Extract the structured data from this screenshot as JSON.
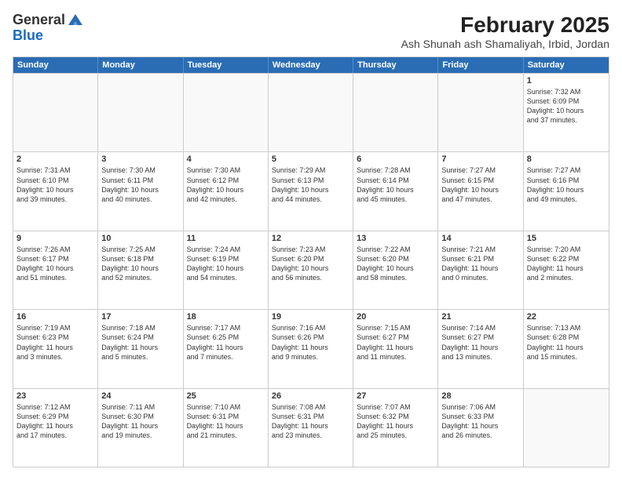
{
  "logo": {
    "general": "General",
    "blue": "Blue"
  },
  "title": "February 2025",
  "location": "Ash Shunah ash Shamaliyah, Irbid, Jordan",
  "days": [
    "Sunday",
    "Monday",
    "Tuesday",
    "Wednesday",
    "Thursday",
    "Friday",
    "Saturday"
  ],
  "weeks": [
    [
      {
        "day": "",
        "info": ""
      },
      {
        "day": "",
        "info": ""
      },
      {
        "day": "",
        "info": ""
      },
      {
        "day": "",
        "info": ""
      },
      {
        "day": "",
        "info": ""
      },
      {
        "day": "",
        "info": ""
      },
      {
        "day": "1",
        "info": "Sunrise: 7:32 AM\nSunset: 6:09 PM\nDaylight: 10 hours\nand 37 minutes."
      }
    ],
    [
      {
        "day": "2",
        "info": "Sunrise: 7:31 AM\nSunset: 6:10 PM\nDaylight: 10 hours\nand 39 minutes."
      },
      {
        "day": "3",
        "info": "Sunrise: 7:30 AM\nSunset: 6:11 PM\nDaylight: 10 hours\nand 40 minutes."
      },
      {
        "day": "4",
        "info": "Sunrise: 7:30 AM\nSunset: 6:12 PM\nDaylight: 10 hours\nand 42 minutes."
      },
      {
        "day": "5",
        "info": "Sunrise: 7:29 AM\nSunset: 6:13 PM\nDaylight: 10 hours\nand 44 minutes."
      },
      {
        "day": "6",
        "info": "Sunrise: 7:28 AM\nSunset: 6:14 PM\nDaylight: 10 hours\nand 45 minutes."
      },
      {
        "day": "7",
        "info": "Sunrise: 7:27 AM\nSunset: 6:15 PM\nDaylight: 10 hours\nand 47 minutes."
      },
      {
        "day": "8",
        "info": "Sunrise: 7:27 AM\nSunset: 6:16 PM\nDaylight: 10 hours\nand 49 minutes."
      }
    ],
    [
      {
        "day": "9",
        "info": "Sunrise: 7:26 AM\nSunset: 6:17 PM\nDaylight: 10 hours\nand 51 minutes."
      },
      {
        "day": "10",
        "info": "Sunrise: 7:25 AM\nSunset: 6:18 PM\nDaylight: 10 hours\nand 52 minutes."
      },
      {
        "day": "11",
        "info": "Sunrise: 7:24 AM\nSunset: 6:19 PM\nDaylight: 10 hours\nand 54 minutes."
      },
      {
        "day": "12",
        "info": "Sunrise: 7:23 AM\nSunset: 6:20 PM\nDaylight: 10 hours\nand 56 minutes."
      },
      {
        "day": "13",
        "info": "Sunrise: 7:22 AM\nSunset: 6:20 PM\nDaylight: 10 hours\nand 58 minutes."
      },
      {
        "day": "14",
        "info": "Sunrise: 7:21 AM\nSunset: 6:21 PM\nDaylight: 11 hours\nand 0 minutes."
      },
      {
        "day": "15",
        "info": "Sunrise: 7:20 AM\nSunset: 6:22 PM\nDaylight: 11 hours\nand 2 minutes."
      }
    ],
    [
      {
        "day": "16",
        "info": "Sunrise: 7:19 AM\nSunset: 6:23 PM\nDaylight: 11 hours\nand 3 minutes."
      },
      {
        "day": "17",
        "info": "Sunrise: 7:18 AM\nSunset: 6:24 PM\nDaylight: 11 hours\nand 5 minutes."
      },
      {
        "day": "18",
        "info": "Sunrise: 7:17 AM\nSunset: 6:25 PM\nDaylight: 11 hours\nand 7 minutes."
      },
      {
        "day": "19",
        "info": "Sunrise: 7:16 AM\nSunset: 6:26 PM\nDaylight: 11 hours\nand 9 minutes."
      },
      {
        "day": "20",
        "info": "Sunrise: 7:15 AM\nSunset: 6:27 PM\nDaylight: 11 hours\nand 11 minutes."
      },
      {
        "day": "21",
        "info": "Sunrise: 7:14 AM\nSunset: 6:27 PM\nDaylight: 11 hours\nand 13 minutes."
      },
      {
        "day": "22",
        "info": "Sunrise: 7:13 AM\nSunset: 6:28 PM\nDaylight: 11 hours\nand 15 minutes."
      }
    ],
    [
      {
        "day": "23",
        "info": "Sunrise: 7:12 AM\nSunset: 6:29 PM\nDaylight: 11 hours\nand 17 minutes."
      },
      {
        "day": "24",
        "info": "Sunrise: 7:11 AM\nSunset: 6:30 PM\nDaylight: 11 hours\nand 19 minutes."
      },
      {
        "day": "25",
        "info": "Sunrise: 7:10 AM\nSunset: 6:31 PM\nDaylight: 11 hours\nand 21 minutes."
      },
      {
        "day": "26",
        "info": "Sunrise: 7:08 AM\nSunset: 6:31 PM\nDaylight: 11 hours\nand 23 minutes."
      },
      {
        "day": "27",
        "info": "Sunrise: 7:07 AM\nSunset: 6:32 PM\nDaylight: 11 hours\nand 25 minutes."
      },
      {
        "day": "28",
        "info": "Sunrise: 7:06 AM\nSunset: 6:33 PM\nDaylight: 11 hours\nand 26 minutes."
      },
      {
        "day": "",
        "info": ""
      }
    ]
  ]
}
